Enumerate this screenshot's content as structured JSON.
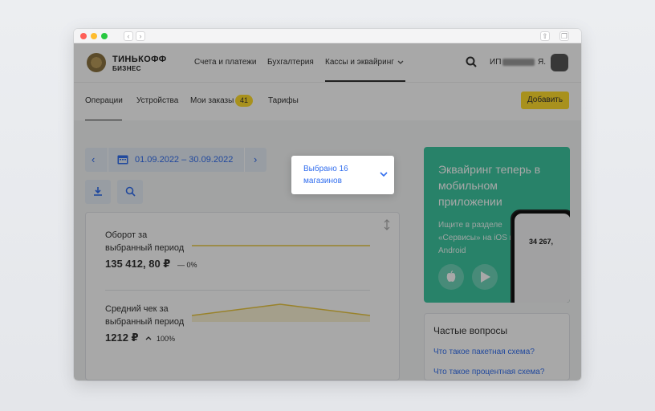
{
  "browser": {
    "back": "‹",
    "forward": "›"
  },
  "header": {
    "logo_line1": "ТИНЬКОФФ",
    "logo_line2": "БИЗНЕС",
    "nav": [
      "Счета и платежи",
      "Бухгалтерия",
      "Кассы и эквайринг"
    ],
    "user_prefix": "ИП",
    "user_suffix": "Я."
  },
  "subnav": {
    "items": [
      "Операции",
      "Устройства",
      "Мои заказы",
      "Тарифы"
    ],
    "orders_count": "41",
    "add_button": "Добавить"
  },
  "filters": {
    "date_range": "01.09.2022 – 30.09.2022",
    "prev": "‹",
    "next": "›",
    "stores_selected": "Выбрано 16 магазинов"
  },
  "metrics": {
    "turnover_title": "Оборот за выбранный период",
    "turnover_value": "135 412, 80 ₽",
    "turnover_delta": "— 0%",
    "avg_title": "Средний чек за выбранный период",
    "avg_value": "1212 ₽",
    "avg_delta": "100%"
  },
  "promo": {
    "title": "Эквайринг теперь в мобильном приложении",
    "text": "Ищите в разделе «Сервисы» на iOS и Android",
    "phone_amount": "34 267,"
  },
  "faq": {
    "title": "Частые вопросы",
    "links": [
      "Что такое пакетная схема?",
      "Что такое процентная схема?"
    ]
  },
  "colors": {
    "accent": "#336fee",
    "yellow": "#ffdd2d",
    "promo": "#3ec6a0"
  }
}
